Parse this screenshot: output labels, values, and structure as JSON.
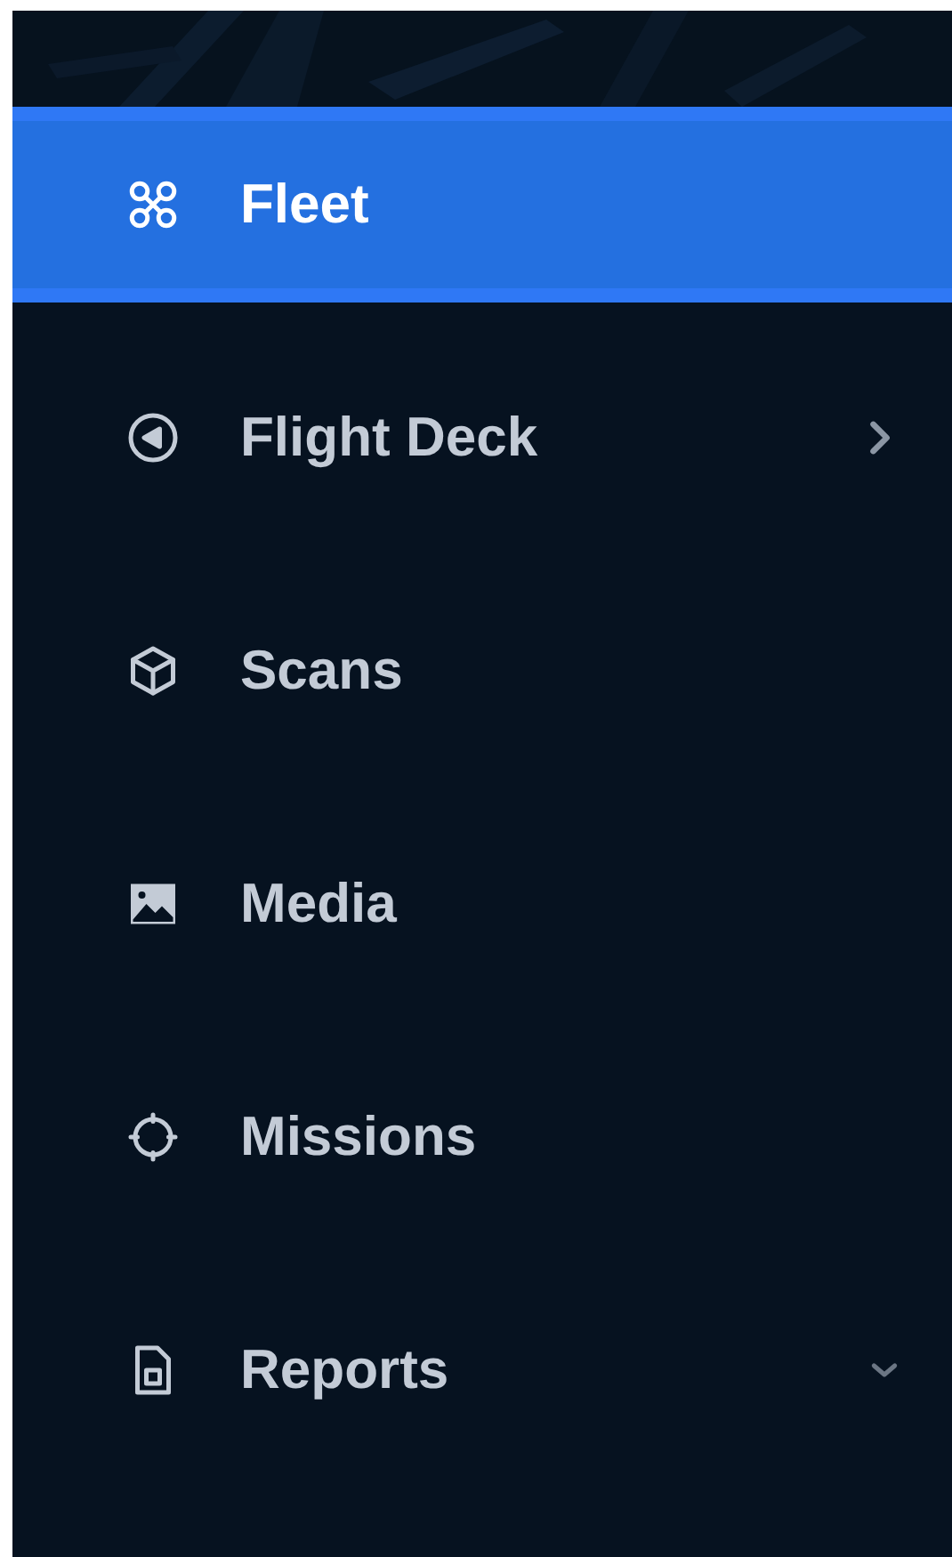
{
  "nav": [
    {
      "label": "Fleet",
      "selected": true,
      "kind": "link"
    },
    {
      "label": "Flight Deck",
      "selected": false,
      "kind": "submenu"
    },
    {
      "label": "Scans",
      "selected": false,
      "kind": "link"
    },
    {
      "label": "Media",
      "selected": false,
      "kind": "link"
    },
    {
      "label": "Missions",
      "selected": false,
      "kind": "link"
    },
    {
      "label": "Reports",
      "selected": false,
      "kind": "dropdown"
    }
  ]
}
